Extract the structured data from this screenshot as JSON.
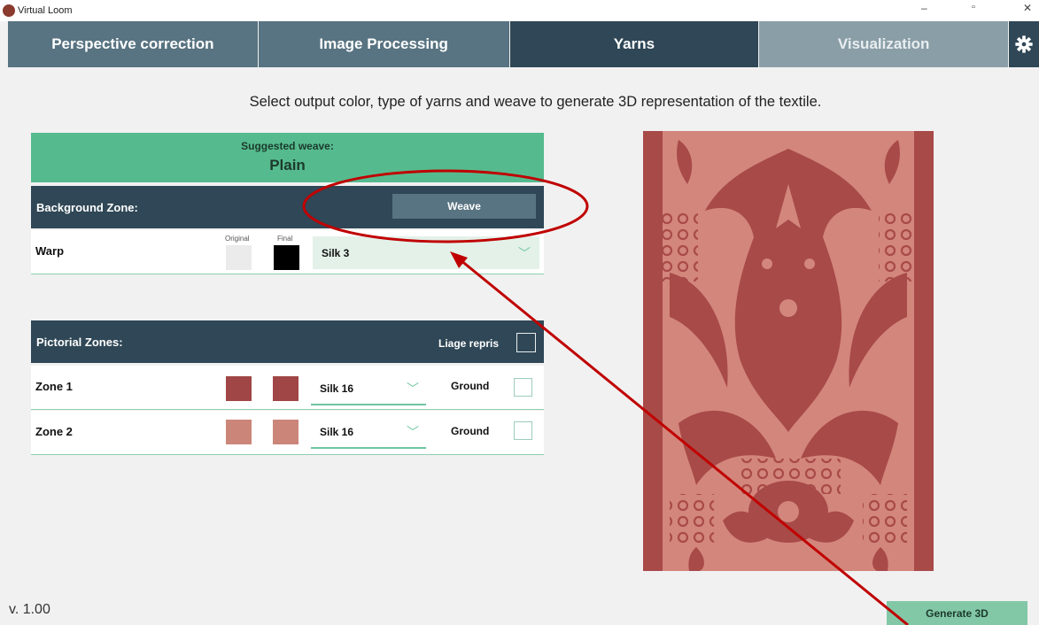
{
  "window": {
    "title": "Virtual Loom",
    "controls": [
      "–",
      "▫",
      "✕"
    ]
  },
  "tabs": [
    "Perspective correction",
    "Image Processing",
    "Yarns",
    "Visualization"
  ],
  "settings_icon": "gear-icon",
  "instructions": "Select output color, type of yarns and weave to generate 3D representation of the textile.",
  "suggested": {
    "label": "Suggested weave:",
    "value": "Plain"
  },
  "background_zone": {
    "title": "Background Zone:",
    "weave_button": "Weave",
    "warp": {
      "label": "Warp",
      "original_label": "Original",
      "final_label": "Final",
      "original_color": "#ebebeb",
      "final_color": "#000000",
      "yarn": "Silk 3"
    }
  },
  "pictorial_zones": {
    "title": "Pictorial Zones:",
    "liage_label": "Liage repris",
    "zones": [
      {
        "label": "Zone 1",
        "original_color": "#a04646",
        "final_color": "#a04646",
        "yarn": "Silk 16",
        "ground_label": "Ground"
      },
      {
        "label": "Zone 2",
        "original_color": "#cb8679",
        "final_color": "#cb8679",
        "yarn": "Silk 16",
        "ground_label": "Ground"
      }
    ]
  },
  "textile_colors": {
    "background": "#d3867c",
    "pattern": "#a84a48"
  },
  "version": "v. 1.00",
  "generate_button": "Generate 3D",
  "annotation_color": "#c00000"
}
